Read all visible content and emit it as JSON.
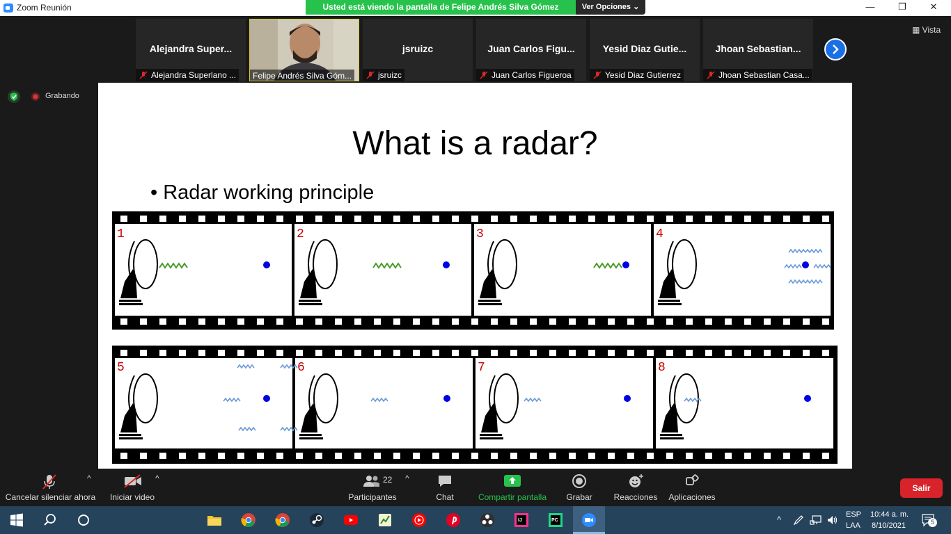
{
  "window": {
    "title": "Zoom Reunión"
  },
  "banner": {
    "text": "Usted está viendo la pantalla de Felipe Andrés Silva Gómez",
    "view_options": "Ver Opciones ⌄"
  },
  "gallery": {
    "participants": [
      {
        "name": "Alejandra  Super...",
        "label": "Alejandra Superlano ..."
      },
      {
        "name": "",
        "label": "Felipe Andrés Silva Góm..."
      },
      {
        "name": "jsruizc",
        "label": "jsruizc"
      },
      {
        "name": "Juan  Carlos  Figu...",
        "label": "Juan Carlos Figueroa"
      },
      {
        "name": "Yesid  Diaz  Gutie...",
        "label": "Yesid Diaz Gutierrez"
      },
      {
        "name": "Jhoan  Sebastian...",
        "label": "Jhoan Sebastian Casa..."
      }
    ],
    "view_label": "Vista"
  },
  "recording": {
    "label": "Grabando"
  },
  "slide": {
    "title": "What is a radar?",
    "bullet": "• Radar working principle",
    "frames": [
      "1",
      "2",
      "3",
      "4",
      "5",
      "6",
      "7",
      "8"
    ]
  },
  "controls": {
    "mute": "Cancelar silenciar ahora",
    "video": "Iniciar video",
    "participants": "Participantes",
    "participants_count": "22",
    "chat": "Chat",
    "share": "Compartir pantalla",
    "record": "Grabar",
    "reactions": "Reacciones",
    "apps": "Aplicaciones",
    "leave": "Salir"
  },
  "taskbar": {
    "lang1": "ESP",
    "lang2": "LAA",
    "time": "10:44 a. m.",
    "date": "8/10/2021",
    "notifications": "5"
  },
  "colors": {
    "share_green": "#27c24c",
    "leave_red": "#d8232a",
    "accent_blue": "#1b6fe6",
    "taskbar": "#26435c"
  }
}
